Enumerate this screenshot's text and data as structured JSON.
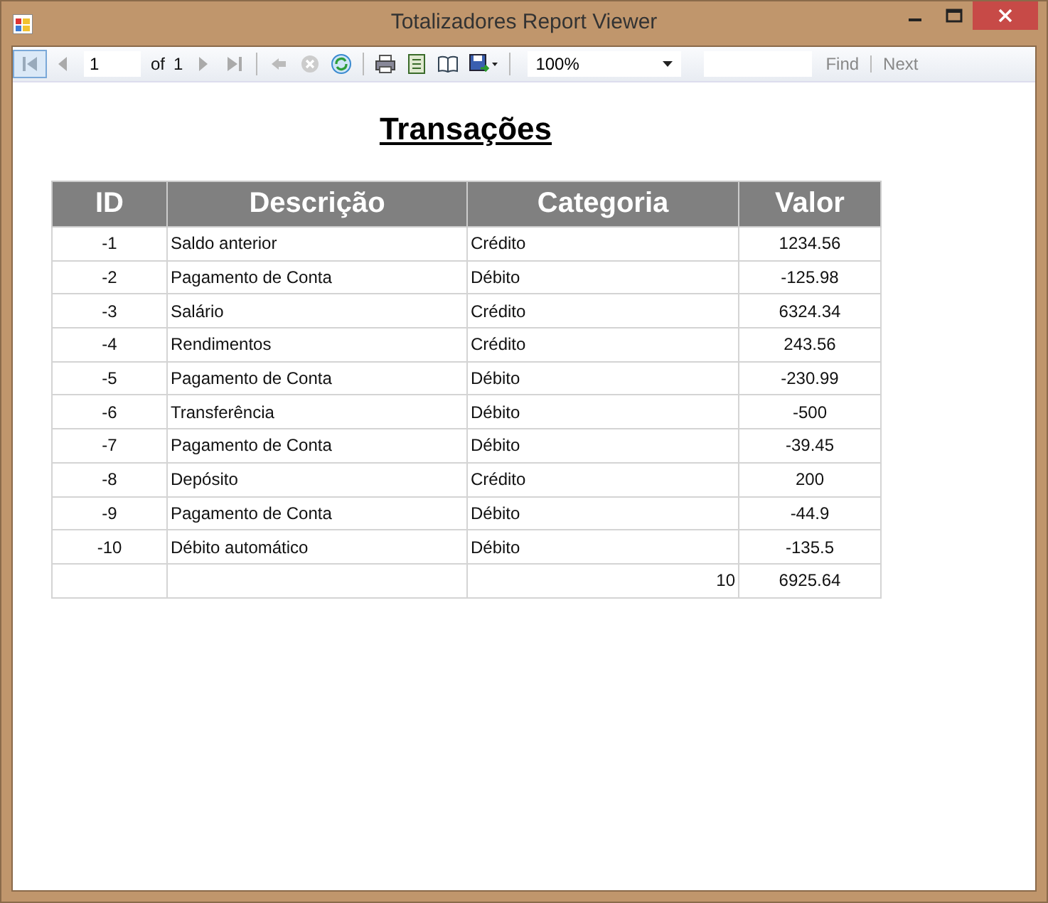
{
  "window": {
    "title": "Totalizadores Report Viewer"
  },
  "toolbar": {
    "page": "1",
    "of_label": "of",
    "page_count": "1",
    "zoom": "100%",
    "find": "Find",
    "next": "Next"
  },
  "report": {
    "title": "Transações",
    "columns": [
      "ID",
      "Descrição",
      "Categoria",
      "Valor"
    ],
    "rows": [
      [
        "-1",
        "Saldo anterior",
        "Crédito",
        "1234.56"
      ],
      [
        "-2",
        "Pagamento de Conta",
        "Débito",
        "-125.98"
      ],
      [
        "-3",
        "Salário",
        "Crédito",
        "6324.34"
      ],
      [
        "-4",
        "Rendimentos",
        "Crédito",
        "243.56"
      ],
      [
        "-5",
        "Pagamento de Conta",
        "Débito",
        "-230.99"
      ],
      [
        "-6",
        "Transferência",
        "Débito",
        "-500"
      ],
      [
        "-7",
        "Pagamento de Conta",
        "Débito",
        "-39.45"
      ],
      [
        "-8",
        "Depósito",
        "Crédito",
        "200"
      ],
      [
        "-9",
        "Pagamento de Conta",
        "Débito",
        "-44.9"
      ],
      [
        "-10",
        "Débito automático",
        "Débito",
        "-135.5"
      ]
    ],
    "totals": {
      "count": "10",
      "sum": "6925.64"
    }
  }
}
